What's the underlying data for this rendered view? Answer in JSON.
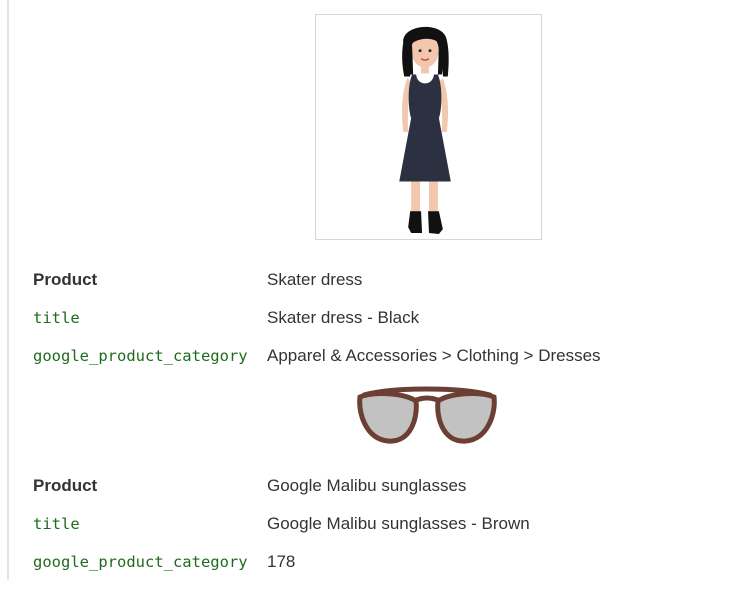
{
  "products": [
    {
      "image_icon": "dress-figure-image",
      "product_label": "Product",
      "product_value": "Skater dress",
      "title_key": "title",
      "title_value": "Skater dress - Black",
      "category_key": "google_product_category",
      "category_value": "Apparel & Accessories > Clothing > Dresses"
    },
    {
      "image_icon": "sunglasses-image",
      "product_label": "Product",
      "product_value": "Google Malibu sunglasses",
      "title_key": "title",
      "title_value": "Google Malibu sunglasses - Brown",
      "category_key": "google_product_category",
      "category_value": "178"
    }
  ],
  "colors": {
    "code_green": "#1e6b1e",
    "text": "#333333",
    "frame_border": "#d6d6d6",
    "dress": "#2b3140",
    "glasses_frame": "#6b3f33",
    "lens": "#c2c2c2"
  }
}
